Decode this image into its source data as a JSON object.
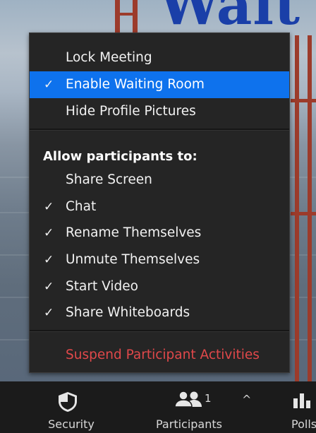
{
  "background": {
    "headline": "Wait"
  },
  "menu": {
    "top_items": [
      {
        "label": "Lock Meeting",
        "checked": false,
        "selected": false
      },
      {
        "label": "Enable Waiting Room",
        "checked": true,
        "selected": true
      },
      {
        "label": "Hide Profile Pictures",
        "checked": false,
        "selected": false
      }
    ],
    "section_title": "Allow participants to:",
    "allow_items": [
      {
        "label": "Share Screen",
        "checked": false
      },
      {
        "label": "Chat",
        "checked": true
      },
      {
        "label": "Rename Themselves",
        "checked": true
      },
      {
        "label": "Unmute Themselves",
        "checked": true
      },
      {
        "label": "Start Video",
        "checked": true
      },
      {
        "label": "Share Whiteboards",
        "checked": true
      }
    ],
    "suspend_label": "Suspend Participant Activities",
    "check_glyph": "✓",
    "accent_color": "#0e72ed",
    "danger_color": "#e0484a"
  },
  "toolbar": {
    "security": {
      "label": "Security",
      "icon": "shield-icon"
    },
    "participants": {
      "label": "Participants",
      "count": "1",
      "icon": "people-icon",
      "caret": "^"
    },
    "polls": {
      "label": "Polls",
      "icon": "bar-chart-icon"
    }
  }
}
